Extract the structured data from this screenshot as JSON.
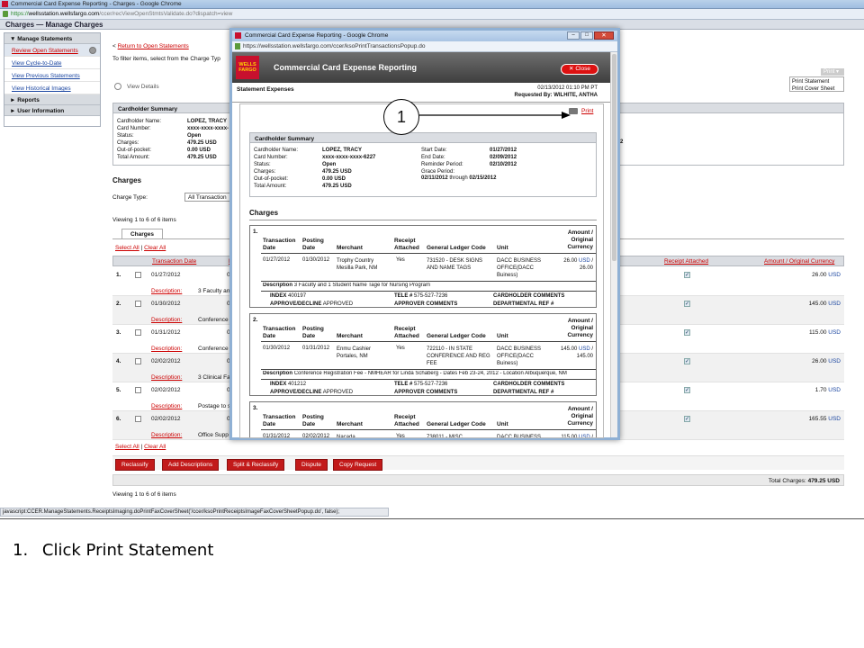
{
  "browser": {
    "title": "Commercial Card Expense Reporting - Charges - Google Chrome",
    "url_https": "https://",
    "url_host": "wellsstation.wellsfargo.com",
    "url_path": "/ccer/recViewOpenStmtsValidate.do?dispatch=view"
  },
  "page_header": "Charges — Manage Charges",
  "nav": {
    "manage_header": "Manage Statements",
    "items": [
      "Review Open Statements",
      "View Cycle-to-Date",
      "View Previous Statements",
      "View Historical Images"
    ],
    "reports": "Reports",
    "user_info": "User Information"
  },
  "main": {
    "return_link": "Return to Open Statements",
    "filter_text": "To filter items, select from the Charge Typ",
    "view_details": "View Details",
    "print_menu_label": "Print",
    "print_options": [
      "Print Statement",
      "Print Cover Sheet"
    ],
    "cardholder_summary_title": "Cardholder Summary",
    "summary_labels": [
      "Cardholder Name:",
      "Card Number:",
      "Status:",
      "Charges:",
      "Out-of-pocket:",
      "Total Amount:"
    ],
    "summary_values": [
      "LOPEZ, TRACY",
      "xxxx-xxxx-xxxx-",
      "Open",
      "479.25 USD",
      "0.00 USD",
      "479.25 USD"
    ],
    "summary_right_fragment": "2",
    "charges_title": "Charges",
    "charge_type_label": "Charge Type:",
    "charge_type_value": "All Transaction",
    "viewing_text": "Viewing 1 to 6 of 6 items",
    "tab_label": "Charges",
    "select_all": "Select All",
    "clear_all": "Clear All",
    "col_transaction_date": "Transaction Date",
    "col_p_fragment": "P",
    "col_receipt_attached": "Receipt Attached",
    "col_amount": "Amount / Original Currency",
    "rows": [
      {
        "num": "1.",
        "date": "01/27/2012",
        "d2": "0",
        "desc_label": "Description",
        "desc": "3 Faculty and",
        "amount": "26.00",
        "currency": "USD"
      },
      {
        "num": "2.",
        "date": "01/30/2012",
        "d2": "0",
        "desc_label": "Description",
        "desc": "Conference",
        "amount": "145.00",
        "currency": "USD"
      },
      {
        "num": "3.",
        "date": "01/31/2012",
        "d2": "0",
        "desc_label": "Description",
        "desc": "Conference",
        "amount": "115.00",
        "currency": "USD"
      },
      {
        "num": "4.",
        "date": "02/02/2012",
        "d2": "0",
        "desc_label": "Description",
        "desc": "3 Clinical Fac",
        "amount": "26.00",
        "currency": "USD"
      },
      {
        "num": "5.",
        "date": "02/02/2012",
        "d2": "0",
        "desc_label": "Description",
        "desc": "Postage to s",
        "amount": "1.70",
        "currency": "USD"
      },
      {
        "num": "6.",
        "date": "02/02/2012",
        "d2": "0",
        "desc_label": "Description",
        "desc": "Office Supp",
        "amount": "165.55",
        "currency": "USD"
      }
    ],
    "buttons": [
      "Reclassify",
      "Add Descriptions",
      "Split & Reclassify",
      "Dispute",
      "Copy Request"
    ],
    "total_label": "Total Charges:",
    "total_value": "479.25 USD"
  },
  "status_bar": "javascript:CCER.ManageStatements.ReceiptsImaging.doPrintFaxCoverSheet('/ccer/ksoPrintReceiptsImageFaxCoverSheetPopup.do', false);",
  "popup": {
    "title": "Commercial Card Expense Reporting - Google Chrome",
    "url": "https://wellsstation.wellsfargo.com/ccer/ksoPrintTransactionsPopup.do",
    "logo": "WELLS FARGO",
    "banner_title": "Commercial Card Expense Reporting",
    "close": "Close",
    "statement_expenses": "Statement Expenses",
    "timestamp": "02/13/2012 01:10 PM PT",
    "requested_by_label": "Requested By:",
    "requested_by": "WILHITE, ANTHA",
    "print_link": "Print",
    "summary_title": "Cardholder Summary",
    "left_labels": [
      "Cardholder Name:",
      "Card Number:",
      "Status:",
      "Charges:",
      "Out-of-pocket:",
      "Total Amount:"
    ],
    "left_values": [
      "LOPEZ, TRACY",
      "xxxx-xxxx-xxxx-6227",
      "Open",
      "479.25 USD",
      "0.00 USD",
      "479.25 USD"
    ],
    "right_labels": [
      "Start Date:",
      "End Date:",
      "Reminder Period:",
      "Grace Period:"
    ],
    "right_values": [
      "01/27/2012",
      "02/09/2012",
      "02/10/2012",
      ""
    ],
    "grace_from": "02/11/2012",
    "grace_through": "through",
    "grace_to": "02/15/2012",
    "charges_title": "Charges",
    "col_headers": {
      "transaction_date": "Transaction Date",
      "posting_date": "Posting Date",
      "merchant": "Merchant",
      "receipt_attached": "Receipt Attached",
      "gl_code": "General Ledger Code",
      "unit": "Unit",
      "amount": "Amount / Original Currency"
    },
    "charges": [
      {
        "num": "1.",
        "tdate": "01/27/2012",
        "pdate": "01/30/2012",
        "merchant": "Trophy Country Mesilla Park, NM",
        "receipt": "Yes",
        "gl": "731520 - DESK SIGNS AND NAME TAGS",
        "unit": "DACC BUSINESS OFFICE(DACC Buiness)",
        "amount": "26.00",
        "ccy": "USD",
        "orig": "26.00",
        "desc_label": "Description",
        "desc": "3 Faculty and 1 Student Name Tage for Nursing Program",
        "index_label": "INDEX",
        "index": "400197",
        "tele_label": "TELE #",
        "tele": "575-527-7236",
        "cardholder_comments": "CARDHOLDER COMMENTS",
        "approve_label": "APPROVE/DECLINE",
        "approve": "APPROVED",
        "approver_comments": "APPROVER COMMENTS",
        "dept_ref": "DEPARTMENTAL REF #"
      },
      {
        "num": "2.",
        "tdate": "01/30/2012",
        "pdate": "01/31/2012",
        "merchant": "Enmu Cashier Portales, NM",
        "receipt": "Yes",
        "gl": "722110 - IN STATE CONFERENCE AND REG FEE",
        "unit": "DACC BUSINESS OFFICE(DACC Buiness)",
        "amount": "145.00",
        "ccy": "USD",
        "orig": "145.00",
        "desc_label": "Description",
        "desc": "Conference Registration Fee - NMHEAR for Linda Schaberg - Dates Feb 23-24, 2012 - Location Albuquerque, NM",
        "index_label": "INDEX",
        "index": "401212",
        "tele_label": "TELE #",
        "tele": "575-527-7236",
        "cardholder_comments": "CARDHOLDER COMMENTS",
        "approve_label": "APPROVE/DECLINE",
        "approve": "APPROVED",
        "approver_comments": "APPROVER COMMENTS",
        "dept_ref": "DEPARTMENTAL REF #"
      },
      {
        "num": "3.",
        "tdate": "01/31/2012",
        "pdate": "02/02/2012",
        "merchant": "Nacada",
        "receipt": "Yes",
        "gl": "738011 - MISC",
        "unit": "DACC BUSINESS OFFICE(DACC",
        "amount": "115.00",
        "ccy": "USD",
        "orig": "",
        "desc_label": "",
        "desc": ""
      }
    ]
  },
  "callout_number": "1",
  "instruction_num": "1.",
  "instruction": "Click Print Statement"
}
